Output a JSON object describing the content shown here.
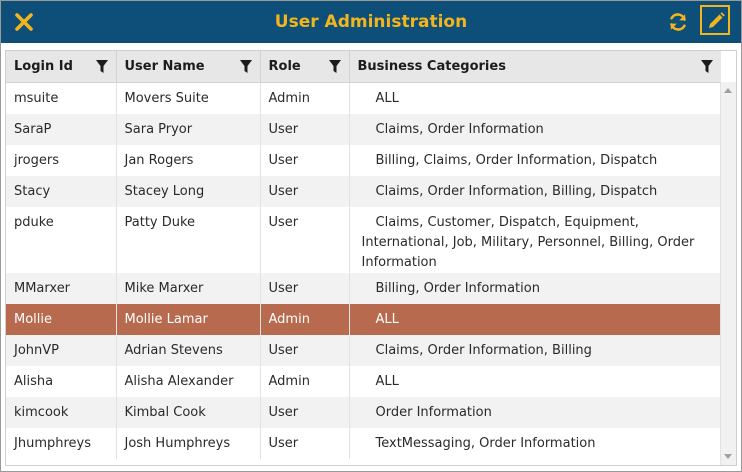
{
  "window": {
    "title": "User Administration"
  },
  "toolbar": {
    "close_icon": "close-icon",
    "refresh_icon": "refresh-icon",
    "edit_icon": "pencil-icon"
  },
  "colors": {
    "titlebar": "#0d4f78",
    "accent": "#f3b51c",
    "selected_row": "#b86a4e"
  },
  "table": {
    "columns": [
      "Login Id",
      "User Name",
      "Role",
      "Business Categories"
    ],
    "rows": [
      {
        "login": "msuite",
        "name": "Movers Suite",
        "role": "Admin",
        "categories": "ALL"
      },
      {
        "login": "SaraP",
        "name": "Sara Pryor",
        "role": "User",
        "categories": "Claims, Order Information"
      },
      {
        "login": "jrogers",
        "name": "Jan Rogers",
        "role": "User",
        "categories": "Billing, Claims, Order Information, Dispatch"
      },
      {
        "login": "Stacy",
        "name": "Stacey Long",
        "role": "User",
        "categories": "Claims, Order Information, Billing, Dispatch"
      },
      {
        "login": "pduke",
        "name": "Patty Duke",
        "role": "User",
        "categories": "Claims, Customer, Dispatch, Equipment, International, Job, Military, Personnel, Billing, Order Information"
      },
      {
        "login": "MMarxer",
        "name": "Mike Marxer",
        "role": "User",
        "categories": "Billing, Order Information"
      },
      {
        "login": "Mollie",
        "name": "Mollie Lamar",
        "role": "Admin",
        "categories": "ALL"
      },
      {
        "login": "JohnVP",
        "name": "Adrian Stevens",
        "role": "User",
        "categories": "Claims, Order Information, Billing"
      },
      {
        "login": "Alisha",
        "name": "Alisha Alexander",
        "role": "Admin",
        "categories": "ALL"
      },
      {
        "login": "kimcook",
        "name": "Kimbal Cook",
        "role": "User",
        "categories": "Order Information"
      },
      {
        "login": "Jhumphreys",
        "name": "Josh Humphreys",
        "role": "User",
        "categories": "TextMessaging, Order Information"
      }
    ]
  }
}
